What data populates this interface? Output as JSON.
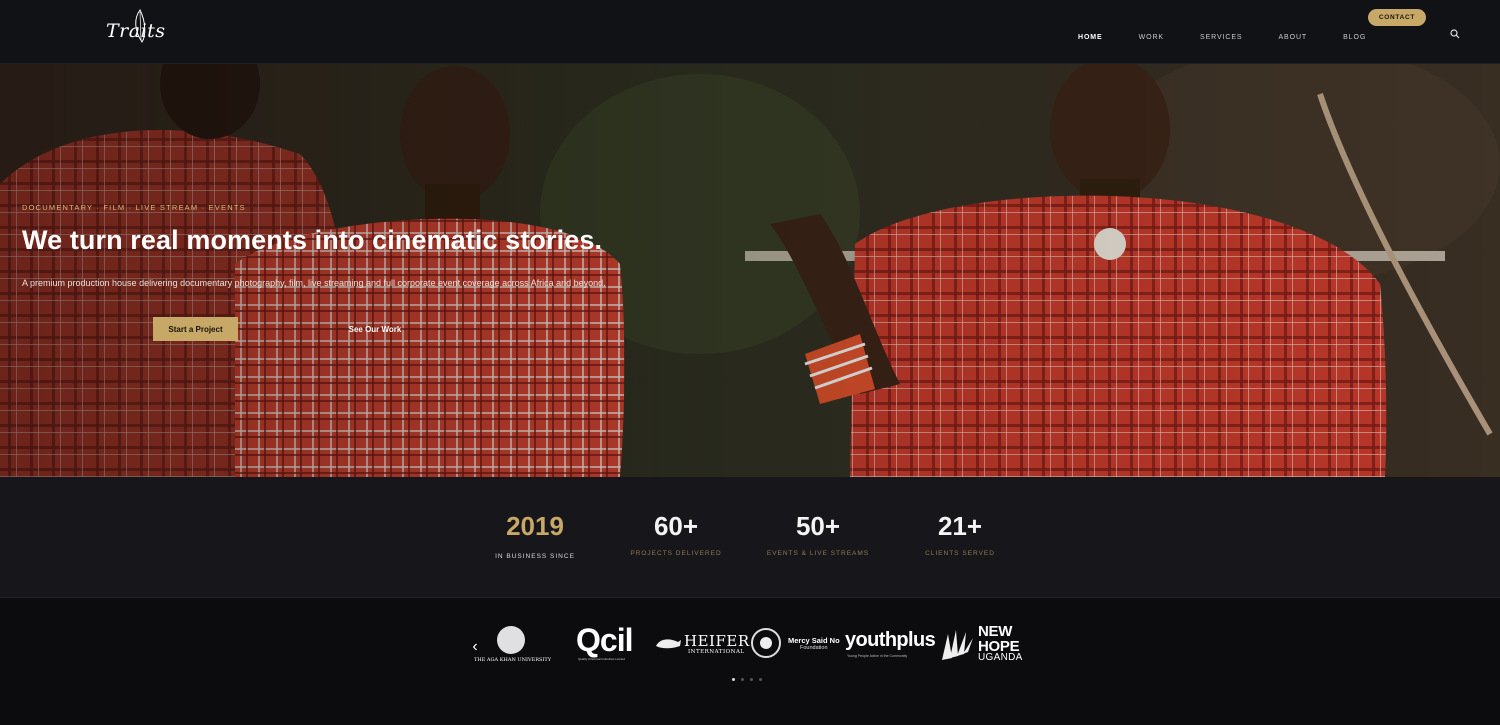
{
  "header": {
    "logo_text": "Traits",
    "nav": [
      {
        "label": "HOME",
        "active": true
      },
      {
        "label": "WORK",
        "active": false
      },
      {
        "label": "SERVICES",
        "active": false
      },
      {
        "label": "ABOUT",
        "active": false
      },
      {
        "label": "BLOG",
        "active": false
      }
    ],
    "contact_label": "CONTACT",
    "search_icon": "search-icon"
  },
  "hero": {
    "eyebrow": "DOCUMENTARY · FILM · LIVE STREAM · EVENTS",
    "headline": "We turn real moments into cinematic stories.",
    "subline": "A premium production house delivering documentary photography, film, live streaming and full corporate event coverage across Africa and beyond.",
    "primary_cta": "Start a Project",
    "secondary_cta": "See Our Work"
  },
  "stats": [
    {
      "value": "2019",
      "label": "IN BUSINESS SINCE"
    },
    {
      "value": "60+",
      "label": "PROJECTS DELIVERED"
    },
    {
      "value": "50+",
      "label": "EVENTS & LIVE STREAMS"
    },
    {
      "value": "21+",
      "label": "CLIENTS SERVED"
    }
  ],
  "clients": {
    "prev_icon": "chevron-left-icon",
    "logos": [
      {
        "name": "THE AGA KHAN UNIVERSITY"
      },
      {
        "name": "Qcil",
        "tagline": "Quality Chemical Industries Limited"
      },
      {
        "name": "HEIFER",
        "tagline": "INTERNATIONAL"
      },
      {
        "name": "Mercy Said No",
        "tagline": "Foundation"
      },
      {
        "name": "youthplus",
        "tagline": "Young People Active in the Community"
      },
      {
        "name": "NEW HOPE",
        "tagline": "UGANDA"
      }
    ],
    "pagination": {
      "total": 4,
      "current": 1
    }
  },
  "colors": {
    "accent": "#c7a867",
    "header_bg": "#111215",
    "stats_bg": "#17171b"
  }
}
